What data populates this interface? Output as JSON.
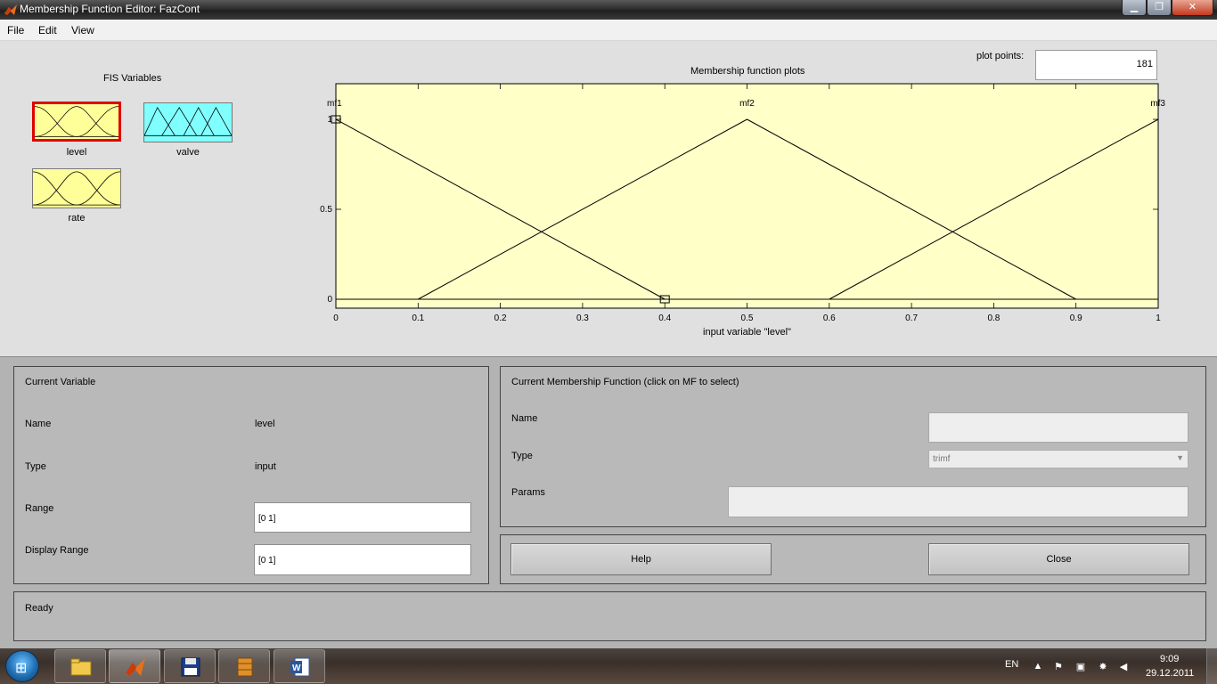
{
  "window": {
    "title": "Membership Function Editor: FazCont",
    "buttons": {
      "minimize": "▁",
      "maximize": "❐",
      "close": "✕"
    }
  },
  "menu": {
    "items": [
      "File",
      "Edit",
      "View"
    ]
  },
  "fis": {
    "title": "FIS Variables",
    "variables": [
      {
        "name": "level",
        "kind": "input",
        "color": "#ffff99",
        "selected": true,
        "selection_color": "#e00000"
      },
      {
        "name": "valve",
        "kind": "output",
        "color": "#80ffff",
        "selected": false
      },
      {
        "name": "rate",
        "kind": "input",
        "color": "#ffff99",
        "selected": false
      }
    ]
  },
  "plot_points": {
    "label": "plot points:",
    "value": "181"
  },
  "chart_data": {
    "type": "line",
    "title": "Membership function plots",
    "xlabel": "input variable \"level\"",
    "ylabel": "",
    "xlim": [
      0,
      1
    ],
    "ylim": [
      0,
      1
    ],
    "x_ticks": [
      "0",
      "0.1",
      "0.2",
      "0.3",
      "0.4",
      "0.5",
      "0.6",
      "0.7",
      "0.8",
      "0.9",
      "1"
    ],
    "y_ticks": [
      "0",
      "0.5",
      "1"
    ],
    "background": "#ffffc8",
    "series": [
      {
        "name": "mf1",
        "x": [
          0,
          0,
          0.4
        ],
        "y": [
          0,
          1,
          0
        ],
        "label_x": 0
      },
      {
        "name": "mf2",
        "x": [
          0.1,
          0.5,
          0.9
        ],
        "y": [
          0,
          1,
          0
        ],
        "label_x": 0.5
      },
      {
        "name": "mf3",
        "x": [
          0.6,
          1,
          1
        ],
        "y": [
          0,
          1,
          0
        ],
        "label_x": 1
      }
    ],
    "handles": [
      {
        "x": 0,
        "y": 1
      },
      {
        "x": 0.4,
        "y": 0
      }
    ]
  },
  "current_variable": {
    "title": "Current Variable",
    "name_label": "Name",
    "name_value": "level",
    "type_label": "Type",
    "type_value": "input",
    "range_label": "Range",
    "range_value": "[0 1]",
    "display_range_label": "Display Range",
    "display_range_value": "[0 1]"
  },
  "current_mf": {
    "title": "Current Membership Function (click on MF to select)",
    "name_label": "Name",
    "name_value": "",
    "type_label": "Type",
    "type_value": "trimf",
    "params_label": "Params",
    "params_value": ""
  },
  "buttons": {
    "help": "Help",
    "close": "Close"
  },
  "status": {
    "text": "Ready"
  },
  "taskbar": {
    "apps": [
      "windows-explorer",
      "matlab",
      "save-disk",
      "archive-books",
      "microsoft-word"
    ],
    "language": "EN",
    "time": "9:09",
    "date": "29.12.2011"
  }
}
